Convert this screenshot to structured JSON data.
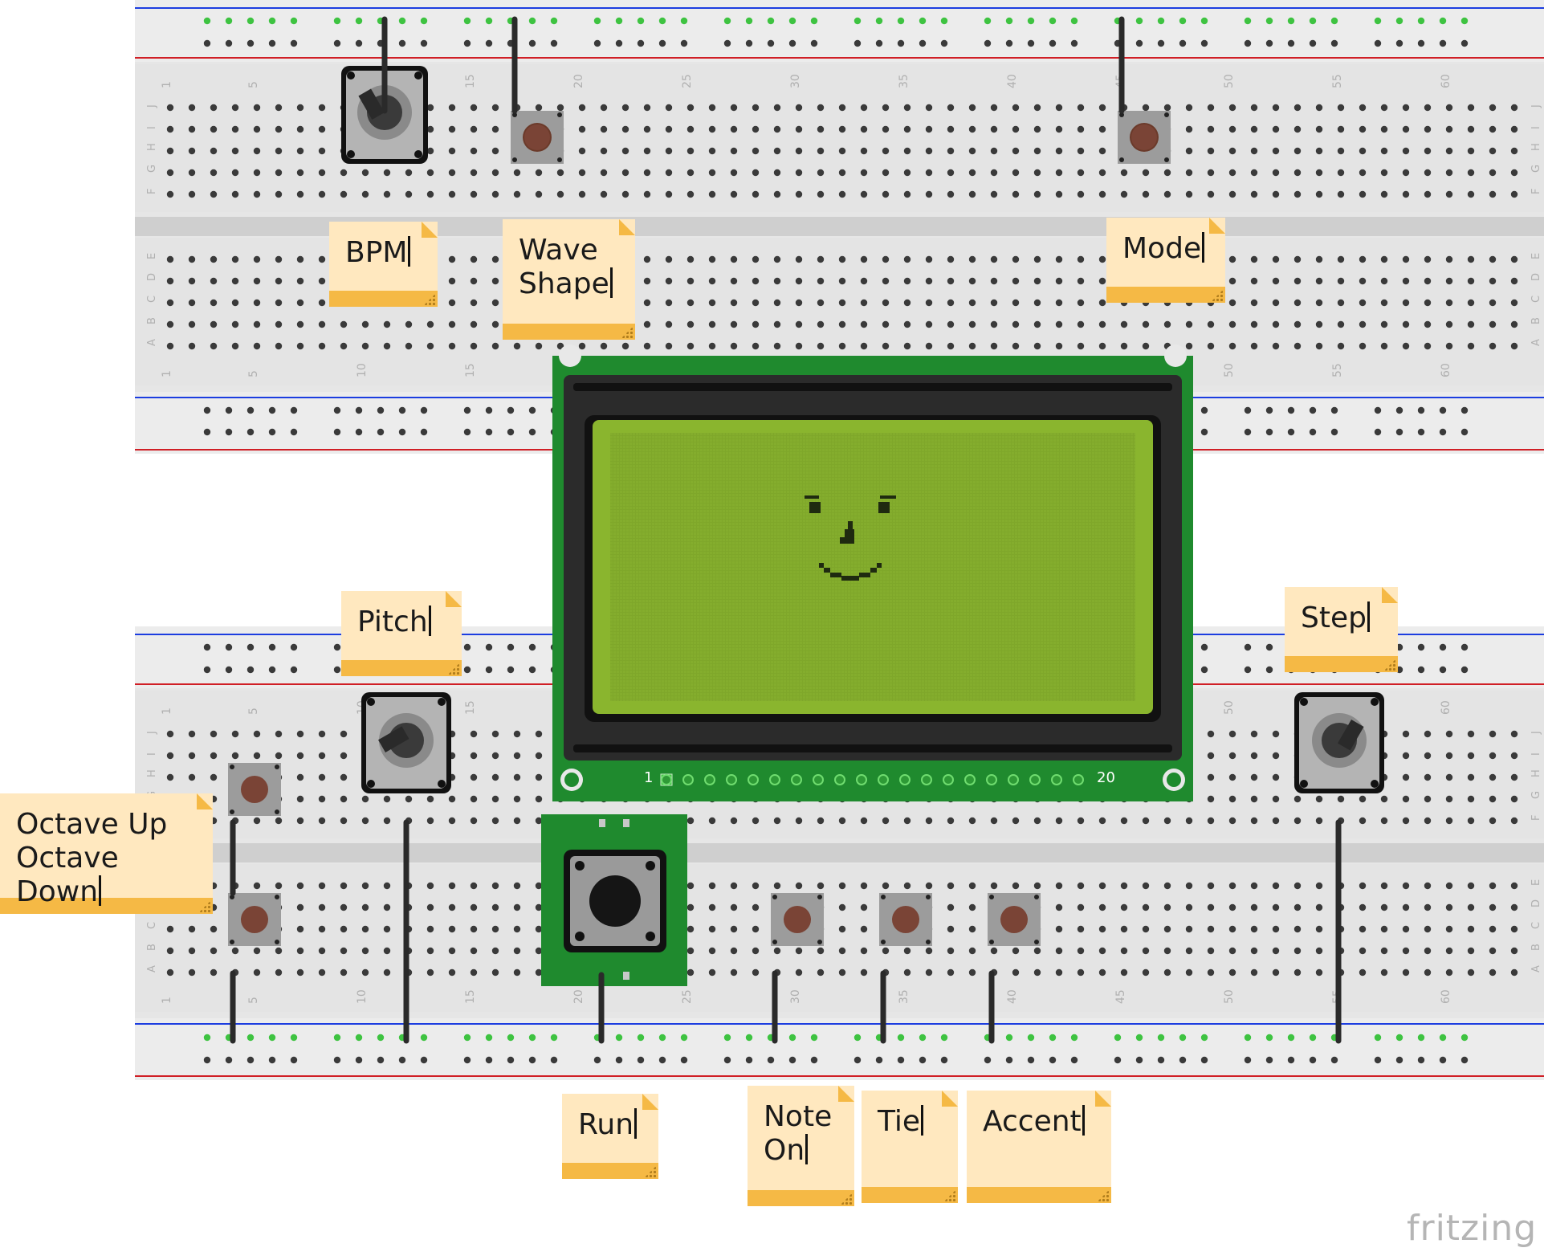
{
  "app": {
    "logo_text": "fritzing"
  },
  "display": {
    "pin_first": "1",
    "pin_last": "20"
  },
  "breadboard": {
    "column_numbers": [
      "1",
      "5",
      "10",
      "15",
      "20",
      "25",
      "30",
      "35",
      "40",
      "45",
      "50",
      "55",
      "60"
    ],
    "row_letters": [
      "J",
      "I",
      "H",
      "G",
      "F",
      "E",
      "D",
      "C",
      "B",
      "A"
    ]
  },
  "notes": [
    {
      "id": "bpm",
      "text": "BPM"
    },
    {
      "id": "wave-shape",
      "text": "Wave\nShape"
    },
    {
      "id": "mode",
      "text": "Mode"
    },
    {
      "id": "pitch",
      "text": "Pitch"
    },
    {
      "id": "step",
      "text": "Step"
    },
    {
      "id": "octave",
      "text": "Octave Up\nOctave Down"
    },
    {
      "id": "run",
      "text": "Run"
    },
    {
      "id": "note-on",
      "text": "Note\nOn"
    },
    {
      "id": "tie",
      "text": "Tie"
    },
    {
      "id": "accent",
      "text": "Accent"
    }
  ],
  "colors": {
    "board": "#e6e6e6",
    "rail_red": "#d01f26",
    "rail_blue": "#1c3de0",
    "hole": "#3a3a3a",
    "hole_active": "#3ec341",
    "pcb_green": "#1f8a2e",
    "lcd_screen": "#7fa72a",
    "note_body": "#ffe8bf",
    "note_bar": "#f5b945"
  }
}
